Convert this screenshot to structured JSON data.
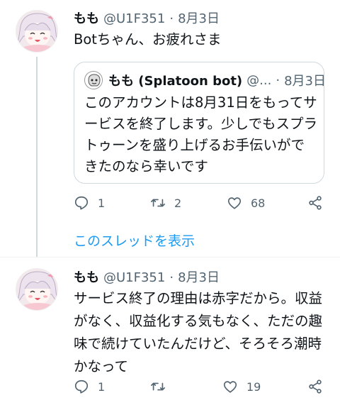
{
  "tweet1": {
    "name": "もも",
    "handle": "@U1F351",
    "date": "8月3日",
    "text": "Botちゃん、お疲れさま",
    "quote": {
      "name": "もも (Splatoon bot)",
      "handle": "@...",
      "date": "8月3日",
      "text": "このアカウントは8月31日をもってサービスを終了します。少しでもスプラトゥーンを盛り上げるお手伝いができたのなら幸いです"
    },
    "replies": "1",
    "retweets": "2",
    "likes": "68"
  },
  "show_thread": "このスレッドを表示",
  "tweet2": {
    "name": "もも",
    "handle": "@U1F351",
    "date": "8月3日",
    "text": "サービス終了の理由は赤字だから。収益がなく、収益化する気もなく、ただの趣味で続けていたんだけど、そろそろ潮時かなって",
    "replies": "1",
    "retweets": "",
    "likes": "19"
  },
  "separator": "·",
  "icons": [
    "avatar",
    "reply-icon",
    "retweet-icon",
    "like-icon",
    "share-icon"
  ],
  "colors": {
    "link": "#1d9bf0",
    "muted": "#536471",
    "border": "#cfd9de"
  }
}
